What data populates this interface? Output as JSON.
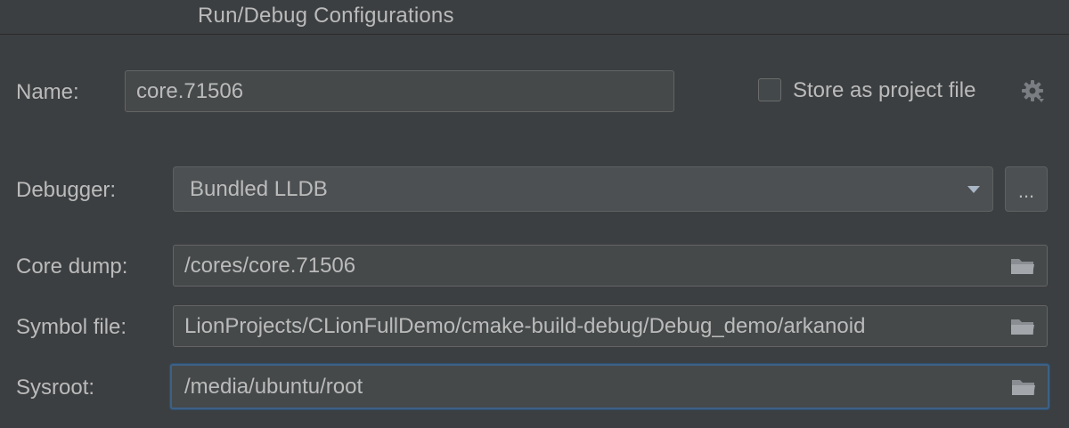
{
  "window": {
    "title": "Run/Debug Configurations"
  },
  "name_row": {
    "label": "Name:",
    "value": "core.71506",
    "store_checkbox_label": "Store as project file",
    "store_checked": false,
    "gear_icon": "gear-icon"
  },
  "debugger_row": {
    "label": "Debugger:",
    "selected": "Bundled LLDB",
    "browse_label": "..."
  },
  "core_dump_row": {
    "label": "Core dump:",
    "value": "/cores/core.71506",
    "icon": "folder-icon"
  },
  "symbol_file_row": {
    "label": "Symbol file:",
    "value": "LionProjects/CLionFullDemo/cmake-build-debug/Debug_demo/arkanoid",
    "icon": "folder-icon"
  },
  "sysroot_row": {
    "label": "Sysroot:",
    "value": "/media/ubuntu/root",
    "icon": "folder-icon"
  },
  "colors": {
    "background": "#3c3f41",
    "field": "#45494a",
    "focus_border": "#3d6185",
    "text": "#bbbbbb"
  }
}
